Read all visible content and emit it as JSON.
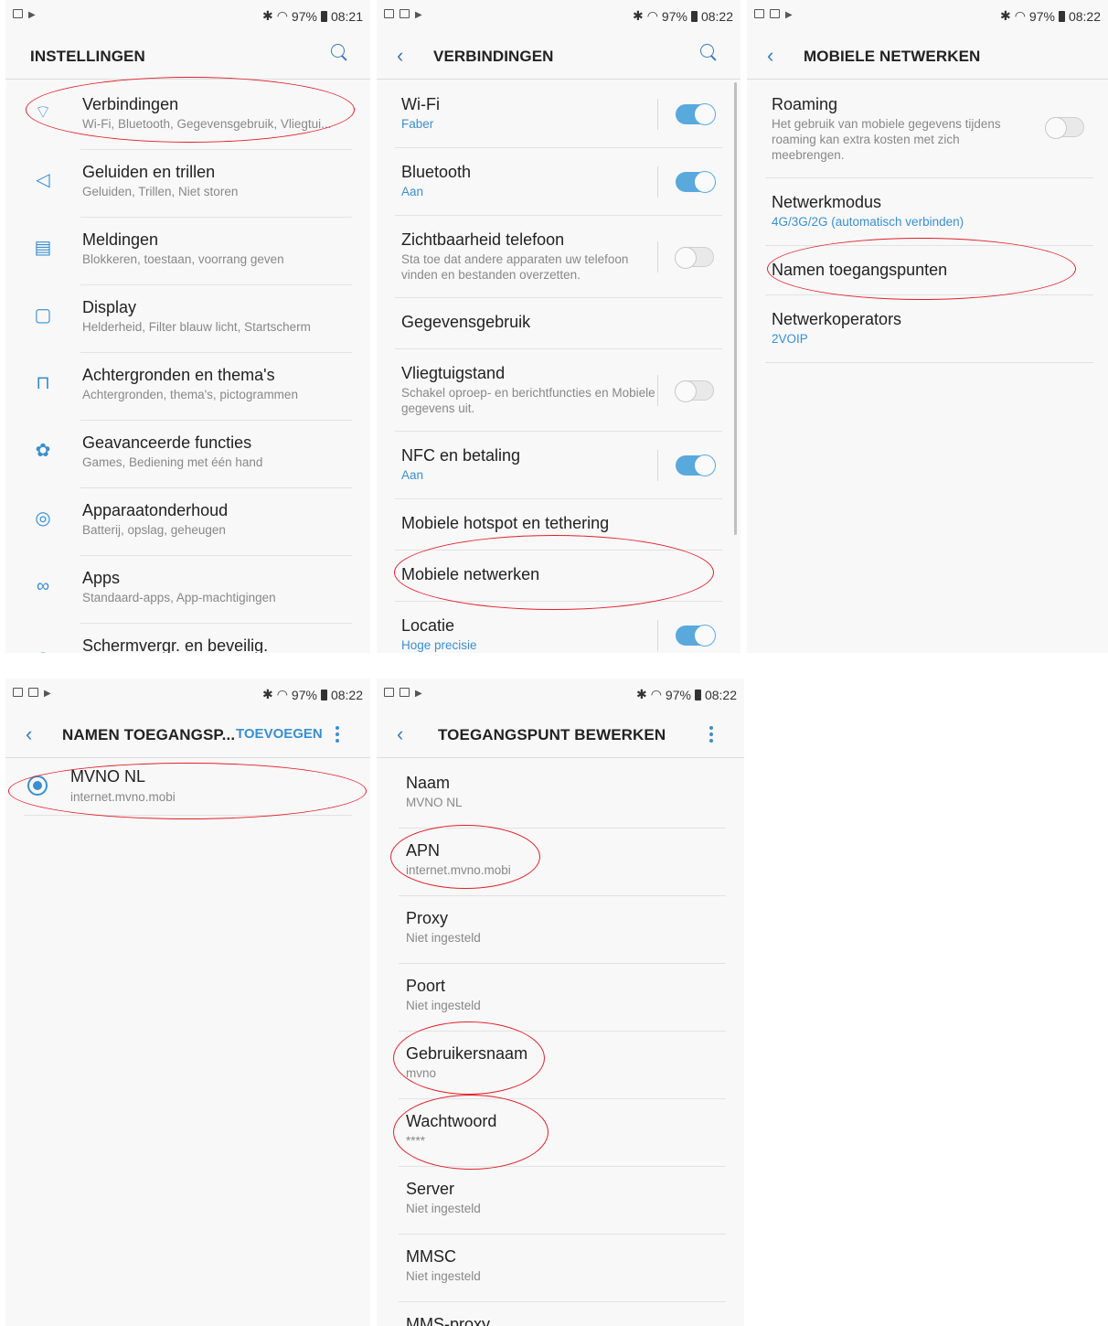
{
  "status": {
    "bluetooth": "✱",
    "signal": "97%",
    "time1": "08:21",
    "time2": "08:22"
  },
  "screen1": {
    "title": "INSTELLINGEN",
    "items": [
      {
        "title": "Verbindingen",
        "sub": "Wi-Fi, Bluetooth, Gegevensgebruik, Vliegtui...",
        "icon": "connections-icon"
      },
      {
        "title": "Geluiden en trillen",
        "sub": "Geluiden, Trillen, Niet storen",
        "icon": "speaker-icon"
      },
      {
        "title": "Meldingen",
        "sub": "Blokkeren, toestaan, voorrang geven",
        "icon": "notifications-icon"
      },
      {
        "title": "Display",
        "sub": "Helderheid, Filter blauw licht, Startscherm",
        "icon": "display-icon"
      },
      {
        "title": "Achtergronden en thema's",
        "sub": "Achtergronden, thema's, pictogrammen",
        "icon": "brush-icon"
      },
      {
        "title": "Geavanceerde functies",
        "sub": "Games, Bediening met één hand",
        "icon": "gear-plus-icon"
      },
      {
        "title": "Apparaatonderhoud",
        "sub": "Batterij, opslag, geheugen",
        "icon": "maintenance-icon"
      },
      {
        "title": "Apps",
        "sub": "Standaard-apps, App-machtigingen",
        "icon": "apps-icon"
      },
      {
        "title": "Schermvergr. en beveilig.",
        "sub": "",
        "icon": "lock-icon"
      }
    ]
  },
  "screen2": {
    "title": "VERBINDINGEN",
    "items": [
      {
        "title": "Wi-Fi",
        "sub": "Faber",
        "toggle": "on"
      },
      {
        "title": "Bluetooth",
        "sub": "Aan",
        "toggle": "on"
      },
      {
        "title": "Zichtbaarheid telefoon",
        "sub": "Sta toe dat andere apparaten uw telefoon vinden en bestanden overzetten.",
        "toggle": "off"
      },
      {
        "title": "Gegevensgebruik",
        "sub": ""
      },
      {
        "title": "Vliegtuigstand",
        "sub": "Schakel oproep- en berichtfuncties en Mobiele gegevens uit.",
        "toggle": "off"
      },
      {
        "title": "NFC en betaling",
        "sub": "Aan",
        "toggle": "on"
      },
      {
        "title": "Mobiele hotspot en tethering",
        "sub": ""
      },
      {
        "title": "Mobiele netwerken",
        "sub": ""
      },
      {
        "title": "Locatie",
        "sub": "Hoge precisie",
        "toggle": "on"
      }
    ]
  },
  "screen3": {
    "title": "MOBIELE NETWERKEN",
    "items": [
      {
        "title": "Roaming",
        "sub": "Het gebruik van mobiele gegevens tijdens roaming kan extra kosten met zich meebrengen.",
        "toggle": "off"
      },
      {
        "title": "Netwerkmodus",
        "sub": "4G/3G/2G (automatisch verbinden)"
      },
      {
        "title": "Namen toegangspunten",
        "sub": ""
      },
      {
        "title": "Netwerkoperators",
        "sub": "2VOIP"
      }
    ]
  },
  "screen4": {
    "title": "NAMEN TOEGANGSP...",
    "action": "TOEVOEGEN",
    "items": [
      {
        "title": "MVNO NL",
        "sub": "internet.mvno.mobi"
      }
    ]
  },
  "screen5": {
    "title": "TOEGANGSPUNT BEWERKEN",
    "items": [
      {
        "title": "Naam",
        "sub": "MVNO NL"
      },
      {
        "title": "APN",
        "sub": "internet.mvno.mobi"
      },
      {
        "title": "Proxy",
        "sub": "Niet ingesteld"
      },
      {
        "title": "Poort",
        "sub": "Niet ingesteld"
      },
      {
        "title": "Gebruikersnaam",
        "sub": "mvno"
      },
      {
        "title": "Wachtwoord",
        "sub": "****"
      },
      {
        "title": "Server",
        "sub": "Niet ingesteld"
      },
      {
        "title": "MMSC",
        "sub": "Niet ingesteld"
      },
      {
        "title": "MMS-proxy",
        "sub": ""
      }
    ]
  },
  "colors": {
    "accent": "#3a8fd0",
    "highlight": "#e0202a"
  }
}
